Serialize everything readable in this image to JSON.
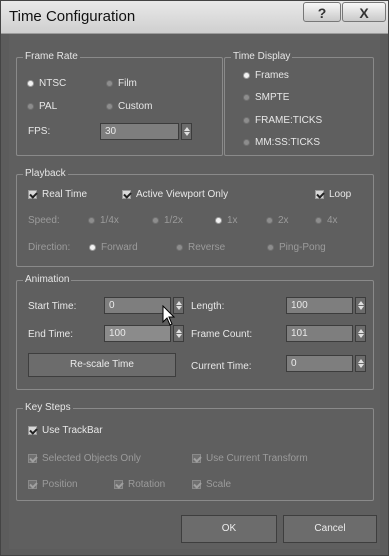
{
  "window": {
    "title": "Time Configuration",
    "help_glyph": "?",
    "close_glyph": "X"
  },
  "frame_rate": {
    "label": "Frame Rate",
    "ntsc": "NTSC",
    "film": "Film",
    "pal": "PAL",
    "custom": "Custom",
    "fps_label": "FPS:",
    "fps_value": "30"
  },
  "time_display": {
    "label": "Time Display",
    "frames": "Frames",
    "smpte": "SMPTE",
    "frame_ticks": "FRAME:TICKS",
    "mmss_ticks": "MM:SS:TICKS"
  },
  "playback": {
    "label": "Playback",
    "real_time": "Real Time",
    "active_viewport": "Active Viewport Only",
    "loop": "Loop",
    "speed_label": "Speed:",
    "speeds": [
      "1/4x",
      "1/2x",
      "1x",
      "2x",
      "4x"
    ],
    "direction_label": "Direction:",
    "directions": [
      "Forward",
      "Reverse",
      "Ping-Pong"
    ]
  },
  "animation": {
    "label": "Animation",
    "start_label": "Start Time:",
    "start_value": "0",
    "end_label": "End Time:",
    "end_value": "100",
    "length_label": "Length:",
    "length_value": "100",
    "frame_count_label": "Frame Count:",
    "frame_count_value": "101",
    "current_label": "Current Time:",
    "current_value": "0",
    "rescale_label": "Re-scale Time"
  },
  "key_steps": {
    "label": "Key Steps",
    "use_trackbar": "Use TrackBar",
    "selected_only": "Selected Objects Only",
    "use_current_transform": "Use Current Transform",
    "position": "Position",
    "rotation": "Rotation",
    "scale": "Scale"
  },
  "footer": {
    "ok": "OK",
    "cancel": "Cancel"
  }
}
